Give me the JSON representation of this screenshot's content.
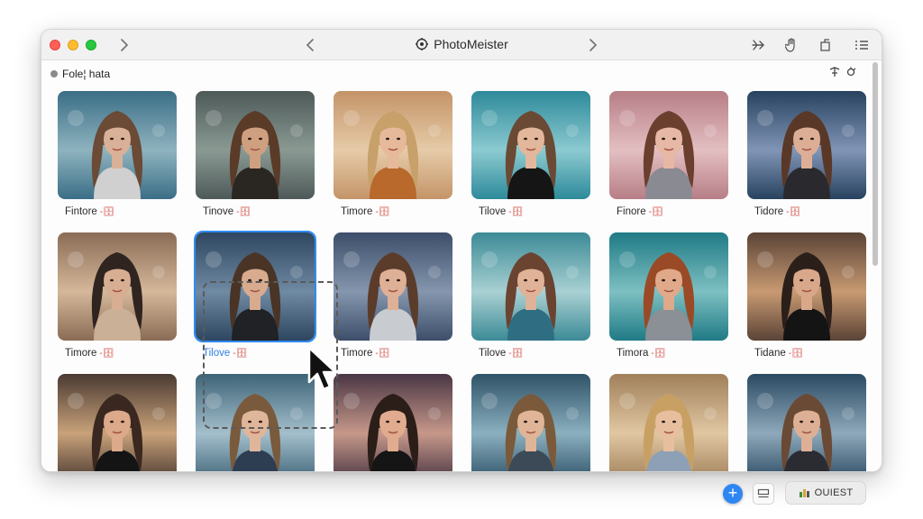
{
  "app": {
    "title": "PhotoMeister"
  },
  "colors": {
    "accent": "#2f8cf5",
    "selection_label": "#2f7fe8",
    "tag": "#d0443c"
  },
  "toolbar": {
    "left_icons": [
      "window-close-light",
      "window-minimize-light",
      "window-zoom-light",
      "chevron-right-icon"
    ],
    "nav_icons": [
      "chevron-left-icon",
      "chevron-right-icon"
    ],
    "right_icons": [
      "share-arrow-icon",
      "hand-icon",
      "sidebar-icon",
      "list-icon"
    ]
  },
  "subbar": {
    "folder_label": "Fole¦ hata",
    "right_icons": [
      "filter-icon",
      "settings-icon"
    ]
  },
  "photos": [
    {
      "caption": "Fintore",
      "tag": "-🗄",
      "palette": [
        "#3a6e86",
        "#8fb3bf",
        "#6b4a36",
        "#d9b198",
        "#d0d0d0"
      ]
    },
    {
      "caption": "Tinove",
      "tag": "-🗄",
      "palette": [
        "#4d5958",
        "#8a9a93",
        "#5a3b28",
        "#cfa080",
        "#2a2622"
      ]
    },
    {
      "caption": "Timore",
      "tag": "-🗄",
      "palette": [
        "#c49468",
        "#e6cba8",
        "#c7a06a",
        "#e6b99a",
        "#b8692b"
      ]
    },
    {
      "caption": "Tilove",
      "tag": "-🗄",
      "palette": [
        "#2d8a9a",
        "#8ccad1",
        "#6a4a34",
        "#e2b79b",
        "#151515"
      ]
    },
    {
      "caption": "Finore",
      "tag": "-🗄",
      "palette": [
        "#b77e86",
        "#e3bfc2",
        "#6b3f2e",
        "#e6b8a5",
        "#8a8a92"
      ]
    },
    {
      "caption": "Tidore",
      "tag": "-🗄",
      "palette": [
        "#27425f",
        "#8195b6",
        "#5a3828",
        "#dcae96",
        "#2a2a2e"
      ]
    },
    {
      "caption": "Timore",
      "tag": "-🗄",
      "palette": [
        "#8a6c56",
        "#d5b79a",
        "#2f2420",
        "#d8ae92",
        "#c9b096"
      ]
    },
    {
      "caption": "Tilove",
      "tag": "-🗄",
      "palette": [
        "#2e4660",
        "#6f8aa3",
        "#4a3426",
        "#d8ab8e",
        "#202226"
      ]
    },
    {
      "caption": "Timore",
      "tag": "-🗄",
      "palette": [
        "#3d4e6a",
        "#8596ae",
        "#5b3c2a",
        "#deb096",
        "#c8ccd0"
      ]
    },
    {
      "caption": "Tilove",
      "tag": "-🗄",
      "palette": [
        "#3b8a96",
        "#a9d1d3",
        "#6b4331",
        "#e0b297",
        "#2f6e82"
      ]
    },
    {
      "caption": "Timora",
      "tag": "-🗄",
      "palette": [
        "#1f7a85",
        "#7dc0c2",
        "#9a4a26",
        "#e0a98a",
        "#8a9096"
      ]
    },
    {
      "caption": "Tidane",
      "tag": "-🗄",
      "palette": [
        "#5a4336",
        "#c89a72",
        "#2b1f1a",
        "#d9a88a",
        "#141414"
      ]
    },
    {
      "caption": "",
      "tag": "",
      "palette": [
        "#4a3a32",
        "#c9a27a",
        "#3a2820",
        "#dca98a",
        "#141414"
      ]
    },
    {
      "caption": "",
      "tag": "",
      "palette": [
        "#3e6478",
        "#a4bfcc",
        "#7a5a3c",
        "#e0b69a",
        "#2e3e52"
      ]
    },
    {
      "caption": "",
      "tag": "",
      "palette": [
        "#4a3644",
        "#c6988a",
        "#2b1d18",
        "#e0ab8e",
        "#151515"
      ]
    },
    {
      "caption": "",
      "tag": "",
      "palette": [
        "#2f5268",
        "#8bb0bf",
        "#7a5a3a",
        "#e0b597",
        "#3c4a58"
      ]
    },
    {
      "caption": "",
      "tag": "",
      "palette": [
        "#a0805a",
        "#e0c7a2",
        "#c8a064",
        "#e8bf9e",
        "#8ea0b6"
      ]
    },
    {
      "caption": "",
      "tag": "",
      "palette": [
        "#2a4a62",
        "#8fa9bb",
        "#6a4a34",
        "#ddb096",
        "#2a2c32"
      ]
    }
  ],
  "selected_index": 7,
  "bottom": {
    "add_label": "+",
    "quest_label": "OUIEST"
  }
}
